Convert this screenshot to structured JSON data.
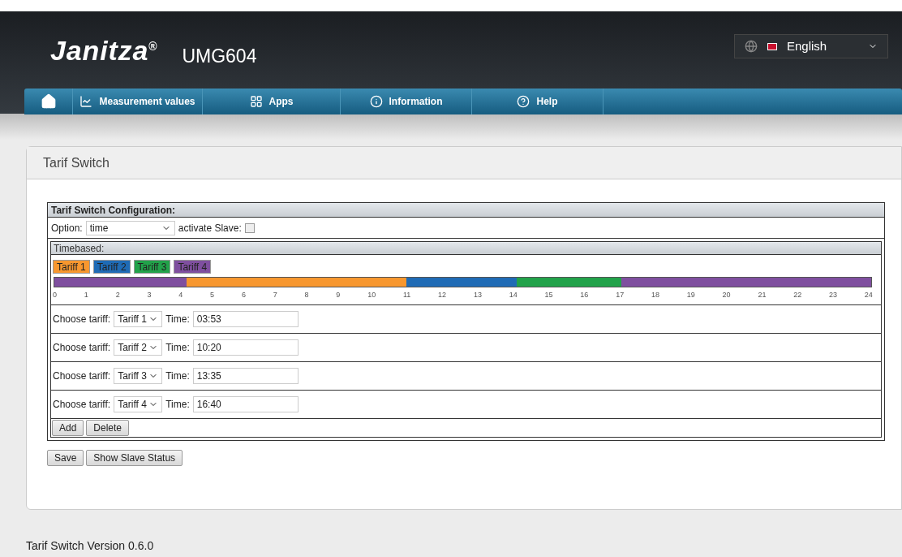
{
  "header": {
    "logo": "Janitza",
    "logo_mark": "®",
    "device": "UMG604",
    "language": "English"
  },
  "nav": [
    {
      "kind": "home"
    },
    {
      "kind": "chart",
      "label": "Measurement values"
    },
    {
      "kind": "apps",
      "label": "Apps"
    },
    {
      "kind": "info",
      "label": "Information"
    },
    {
      "kind": "help",
      "label": "Help"
    }
  ],
  "panel": {
    "title": "Tarif Switch"
  },
  "config": {
    "title": "Tarif Switch Configuration:",
    "option_label": "Option:",
    "option_value": "time",
    "slave_label": "activate Slave:",
    "slave_checked": false
  },
  "timebased": {
    "title": "Timebased:",
    "legend": [
      {
        "label": "Tariff 1",
        "color": "#f7972f"
      },
      {
        "label": "Tariff 2",
        "color": "#1f6bb5"
      },
      {
        "label": "Tariff 3",
        "color": "#22a24a"
      },
      {
        "label": "Tariff 4",
        "color": "#7f4f9f"
      }
    ],
    "ticks": [
      "0",
      "1",
      "2",
      "3",
      "4",
      "5",
      "6",
      "7",
      "8",
      "9",
      "10",
      "11",
      "12",
      "13",
      "14",
      "15",
      "16",
      "17",
      "18",
      "19",
      "20",
      "21",
      "22",
      "23",
      "24"
    ],
    "rows": [
      {
        "label": "Choose tariff:",
        "tariff": "Tariff 1",
        "time_label": "Time:",
        "time": "03:53"
      },
      {
        "label": "Choose tariff:",
        "tariff": "Tariff 2",
        "time_label": "Time:",
        "time": "10:20"
      },
      {
        "label": "Choose tariff:",
        "tariff": "Tariff 3",
        "time_label": "Time:",
        "time": "13:35"
      },
      {
        "label": "Choose tariff:",
        "tariff": "Tariff 4",
        "time_label": "Time:",
        "time": "16:40"
      }
    ],
    "buttons": [
      "Add",
      "Delete"
    ]
  },
  "buttons": [
    "Save",
    "Show Slave Status"
  ],
  "footer": "Tarif Switch Version 0.6.0"
}
